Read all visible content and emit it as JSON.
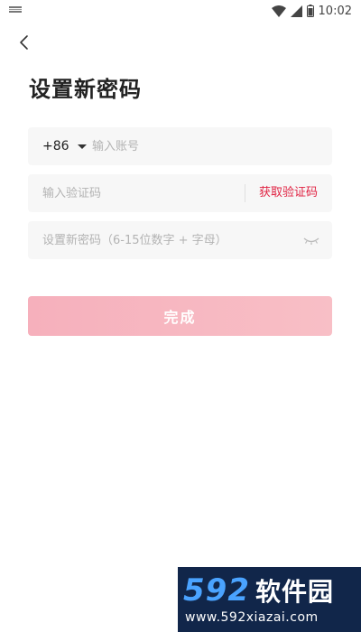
{
  "status_bar": {
    "time": "10:02",
    "icons": [
      "notification-icon",
      "wifi-icon",
      "signal-icon",
      "battery-icon"
    ]
  },
  "header": {
    "back_icon": "chevron-left-icon",
    "title": "设置新密码"
  },
  "form": {
    "country_code": "+86",
    "account_placeholder": "输入账号",
    "code_placeholder": "输入验证码",
    "get_code_label": "获取验证码",
    "password_placeholder": "设置新密码（6-15位数字 + 字母）",
    "password_toggle_icon": "eye-closed-icon"
  },
  "submit": {
    "label": "完成"
  },
  "watermark": {
    "logo_number": "592",
    "logo_text": "软件园",
    "url": "www.592xiazai.com"
  },
  "colors": {
    "accent_red": "#e02242",
    "button_pink": "#f6b0bc",
    "field_bg": "#f7f7f7"
  }
}
